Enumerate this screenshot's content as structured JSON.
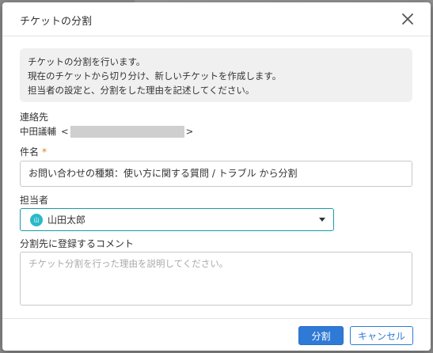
{
  "dialog": {
    "title": "チケットの分割",
    "info_lines": [
      "チケットの分割を行います。",
      "現在のチケットから切り分け、新しいチケットを作成します。",
      "担当者の設定と、分割をした理由を記述してください。"
    ]
  },
  "contact": {
    "label": "連絡先",
    "name": "中田議輔",
    "open_bracket": "<",
    "close_bracket": ">"
  },
  "subject": {
    "label": "件名",
    "required_mark": "*",
    "value": "お問い合わせの種類：使い方に関する質問 / トラブル から分割"
  },
  "assignee": {
    "label": "担当者",
    "avatar_text": "山",
    "value": "山田太郎"
  },
  "comment": {
    "label": "分割先に登録するコメント",
    "placeholder": "チケット分割を行った理由を説明してください。"
  },
  "footer": {
    "submit_label": "分割",
    "cancel_label": "キャンセル"
  },
  "colors": {
    "primary": "#2f7ad6",
    "accent": "#2ab9c7",
    "required": "#e07a1f"
  }
}
